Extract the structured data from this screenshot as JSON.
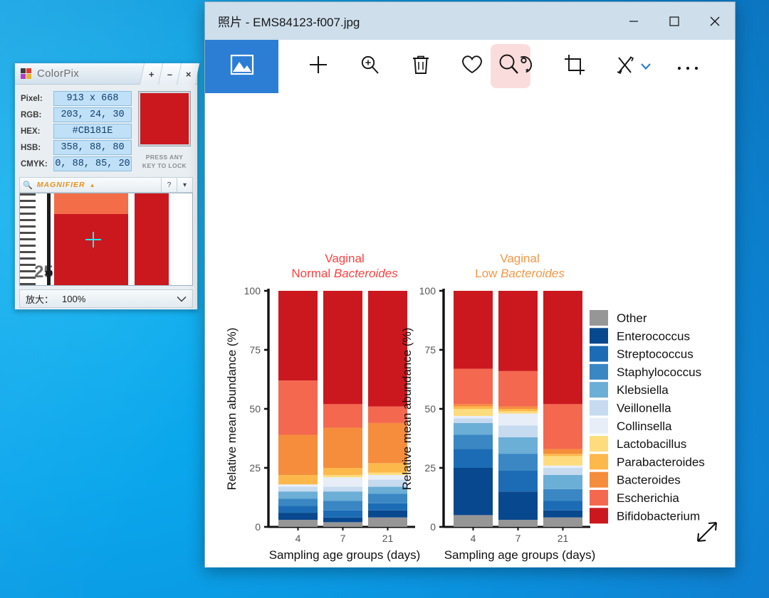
{
  "desktop": {
    "background_color": "#0ba6ec"
  },
  "colorpix": {
    "app_name": "ColorPix",
    "logo_icon": "colorpix-logo-icon",
    "title_buttons": [
      {
        "name": "plus-button",
        "label": "+"
      },
      {
        "name": "minimize-button",
        "label": "–"
      },
      {
        "name": "close-button",
        "label": "×"
      }
    ],
    "fields": [
      {
        "label": "Pixel:",
        "value": "913 x 668"
      },
      {
        "label": "RGB:",
        "value": "203, 24, 30"
      },
      {
        "label": "HEX:",
        "value": "#CB181E"
      },
      {
        "label": "HSB:",
        "value": "358, 88, 80"
      },
      {
        "label": "CMYK:",
        "value": "0, 88, 85, 20"
      }
    ],
    "swatch_color": "#CB181E",
    "lock_hint_line1": "PRESS ANY",
    "lock_hint_line2": "KEY TO LOCK",
    "magnifier": {
      "title": "MAGNIFIER",
      "collapse_icon": "▲",
      "help_label": "?",
      "menu_label": "▾",
      "axis_value": "25"
    },
    "zoom": {
      "label": "放大：",
      "value": "100%",
      "caret": "⌄"
    }
  },
  "photos": {
    "window_title": "照片 - EMS84123-f007.jpg",
    "window_controls": [
      {
        "name": "minimize-button",
        "glyph": "─"
      },
      {
        "name": "maximize-button",
        "glyph": "□"
      },
      {
        "name": "close-button",
        "glyph": "✕"
      }
    ],
    "toolbar": [
      {
        "name": "gallery-thumbnail-button",
        "icon": "image-icon",
        "highlighted": false
      },
      {
        "name": "add-button",
        "icon": "plus-icon"
      },
      {
        "name": "zoom-button",
        "icon": "zoom-in-icon"
      },
      {
        "name": "delete-button",
        "icon": "trash-icon"
      },
      {
        "name": "favorite-button",
        "icon": "heart-icon"
      },
      {
        "name": "rotate-button",
        "icon": "rotate-icon",
        "highlighted": true
      },
      {
        "name": "crop-button",
        "icon": "crop-icon"
      },
      {
        "name": "edit-button",
        "icon": "pen-draw-icon"
      },
      {
        "name": "edit-dropdown",
        "icon": "chevron-down-icon"
      },
      {
        "name": "more-button",
        "icon": "ellipsis-icon"
      }
    ],
    "expand_icon": "expand-diagonal-icon"
  },
  "chart_data": {
    "type": "bar",
    "subtype": "stacked-percent",
    "panels": [
      {
        "title_line1": "Vaginal",
        "title_line2_normal": "Normal ",
        "title_line2_italic": "Bacteroides",
        "title_color": "#FF4040",
        "xlabel": "Sampling age groups (days)",
        "ylabel": "Relative mean abundance (%)",
        "categories": [
          "4",
          "7",
          "21"
        ],
        "ylim": [
          0,
          100
        ],
        "yticks": [
          0,
          25,
          50,
          75,
          100
        ],
        "series": [
          {
            "name": "Bifidobacterium",
            "values": [
              38,
              48,
              49
            ]
          },
          {
            "name": "Escherichia",
            "values": [
              23,
              10,
              7
            ]
          },
          {
            "name": "Bacteroides",
            "values": [
              17,
              17,
              17
            ]
          },
          {
            "name": "Parabacteroides",
            "values": [
              4,
              3,
              4
            ]
          },
          {
            "name": "Lactobacillus",
            "values": [
              0,
              1,
              1
            ]
          },
          {
            "name": "Collinsella",
            "values": [
              1,
              4,
              2
            ]
          },
          {
            "name": "Veillonella",
            "values": [
              2,
              2,
              3
            ]
          },
          {
            "name": "Klebsiella",
            "values": [
              3,
              4,
              3
            ]
          },
          {
            "name": "Staphylococcus",
            "values": [
              3,
              4,
              4
            ]
          },
          {
            "name": "Streptococcus",
            "values": [
              3,
              3,
              3
            ]
          },
          {
            "name": "Enterococcus",
            "values": [
              3,
              2,
              3
            ]
          },
          {
            "name": "Other",
            "values": [
              3,
              2,
              4
            ]
          }
        ]
      },
      {
        "title_line1": "Vaginal",
        "title_line2_normal": "Low ",
        "title_line2_italic": "Bacteroides",
        "title_color": "#F79646",
        "xlabel": "Sampling age groups (days)",
        "ylabel": "Relative mean abundance (%)",
        "categories": [
          "4",
          "7",
          "21"
        ],
        "ylim": [
          0,
          100
        ],
        "yticks": [
          0,
          25,
          50,
          75,
          100
        ],
        "series": [
          {
            "name": "Bifidobacterium",
            "values": [
              33,
              34,
              48
            ]
          },
          {
            "name": "Escherichia",
            "values": [
              15,
              15,
              19
            ]
          },
          {
            "name": "Bacteroides",
            "values": [
              1,
              1,
              2
            ]
          },
          {
            "name": "Parabacteroides",
            "values": [
              1,
              1,
              1
            ]
          },
          {
            "name": "Lactobacillus",
            "values": [
              3,
              1,
              4
            ]
          },
          {
            "name": "Collinsella",
            "values": [
              1,
              5,
              1
            ]
          },
          {
            "name": "Veillonella",
            "values": [
              2,
              5,
              3
            ]
          },
          {
            "name": "Klebsiella",
            "values": [
              5,
              7,
              6
            ]
          },
          {
            "name": "Staphylococcus",
            "values": [
              6,
              7,
              5
            ]
          },
          {
            "name": "Streptococcus",
            "values": [
              8,
              9,
              4
            ]
          },
          {
            "name": "Enterococcus",
            "values": [
              20,
              12,
              3
            ]
          },
          {
            "name": "Other",
            "values": [
              5,
              3,
              4
            ]
          }
        ]
      }
    ],
    "legend": {
      "position": "right",
      "entries": [
        {
          "label": "Other",
          "color": "#969696"
        },
        {
          "label": "Enterococcus",
          "color": "#08488E"
        },
        {
          "label": "Streptococcus",
          "color": "#1C6CB5"
        },
        {
          "label": "Staphylococcus",
          "color": "#3A87C4"
        },
        {
          "label": "Klebsiella",
          "color": "#6BAED6"
        },
        {
          "label": "Veillonella",
          "color": "#C6DBEF"
        },
        {
          "label": "Collinsella",
          "color": "#E7EEF8"
        },
        {
          "label": "Lactobacillus",
          "color": "#FEDC7D"
        },
        {
          "label": "Parabacteroides",
          "color": "#FDB84C"
        },
        {
          "label": "Bacteroides",
          "color": "#F58D3C"
        },
        {
          "label": "Escherichia",
          "color": "#F4684F"
        },
        {
          "label": "Bifidobacterium",
          "color": "#CB181E"
        }
      ]
    }
  }
}
